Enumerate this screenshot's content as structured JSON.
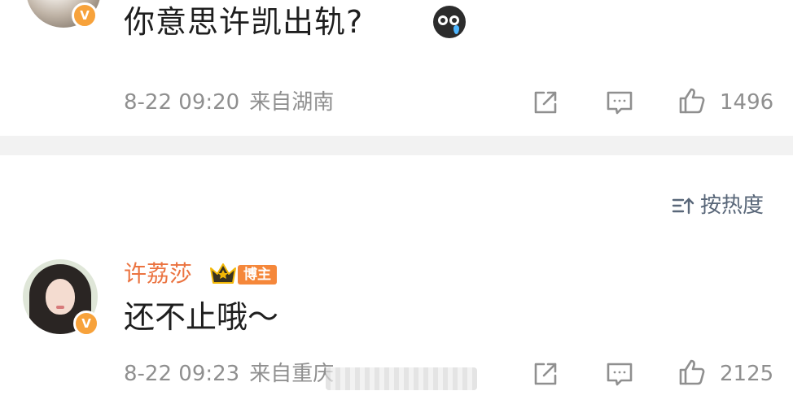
{
  "post1": {
    "text": "你意思许凯出轨?",
    "emoji": "crying-face-icon",
    "date": "8-22 09:20",
    "location": "来自湖南",
    "likes": "1496"
  },
  "sort": {
    "label": "按热度"
  },
  "post2": {
    "username": "许荔莎",
    "badge": "博主",
    "text": "还不止哦～",
    "date": "8-22 09:23",
    "location": "来自重庆",
    "likes": "2125"
  },
  "colors": {
    "accent_orange": "#eb7340",
    "verified": "#f7a23b",
    "meta_gray": "#8f8f8f",
    "sort_blue": "#596779",
    "separator": "#f2f2f2"
  }
}
